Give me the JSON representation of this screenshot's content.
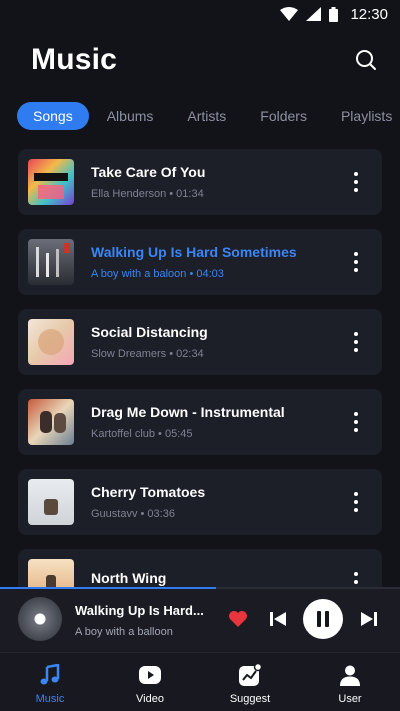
{
  "status": {
    "time": "12:30"
  },
  "header": {
    "title": "Music"
  },
  "tabs": [
    {
      "label": "Songs",
      "active": true
    },
    {
      "label": "Albums"
    },
    {
      "label": "Artists"
    },
    {
      "label": "Folders"
    },
    {
      "label": "Playlists"
    }
  ],
  "songs": [
    {
      "title": "Take Care Of You",
      "meta": "Ella Henderson • 01:34"
    },
    {
      "title": "Walking Up Is Hard Sometimes",
      "meta": "A boy with a baloon • 04:03",
      "playing": true
    },
    {
      "title": "Social Distancing",
      "meta": "Slow Dreamers • 02:34"
    },
    {
      "title": "Drag Me Down - Instrumental",
      "meta": "Kartoffel club • 05:45"
    },
    {
      "title": "Cherry Tomatoes",
      "meta": "Guustavv • 03:36"
    },
    {
      "title": "North Wing",
      "meta": ""
    }
  ],
  "player": {
    "title": "Walking Up Is Hard...",
    "artist": "A boy with a balloon",
    "progress": 0.54
  },
  "nav": [
    {
      "label": "Music",
      "icon": "music-note-icon",
      "active": true
    },
    {
      "label": "Video",
      "icon": "video-icon"
    },
    {
      "label": "Suggest",
      "icon": "suggest-icon"
    },
    {
      "label": "User",
      "icon": "user-icon"
    }
  ],
  "colors": {
    "accent": "#2f7bf0",
    "background": "#121319",
    "card": "#1c1e28",
    "heart": "#e8343d"
  }
}
